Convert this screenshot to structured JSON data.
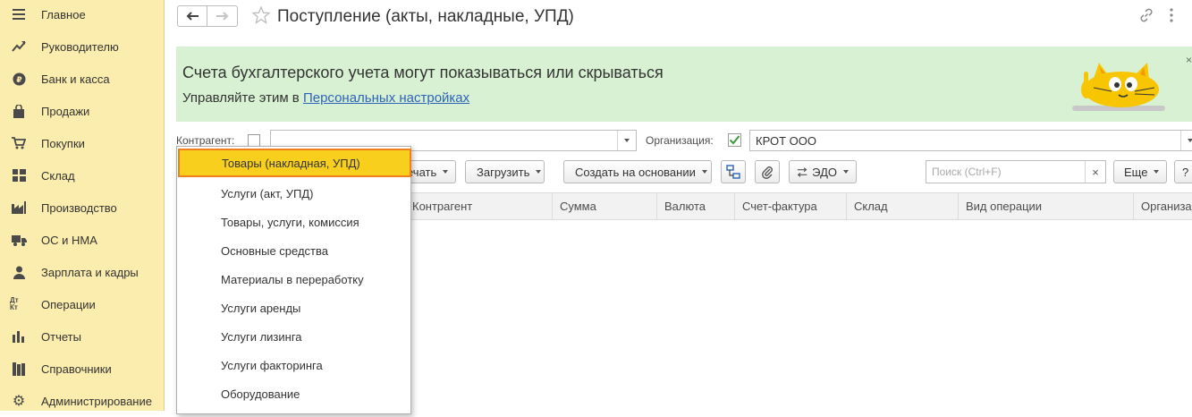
{
  "sidebar": {
    "items": [
      {
        "label": "Главное",
        "icon": "menu-icon"
      },
      {
        "label": "Руководителю",
        "icon": "chart-up-icon"
      },
      {
        "label": "Банк и касса",
        "icon": "ruble-icon"
      },
      {
        "label": "Продажи",
        "icon": "shopping-bag-icon"
      },
      {
        "label": "Покупки",
        "icon": "cart-icon"
      },
      {
        "label": "Склад",
        "icon": "warehouse-icon"
      },
      {
        "label": "Производство",
        "icon": "factory-icon"
      },
      {
        "label": "ОС и НМА",
        "icon": "truck-icon"
      },
      {
        "label": "Зарплата и кадры",
        "icon": "person-icon"
      },
      {
        "label": "Операции",
        "icon": "dt-kt-icon",
        "icon_text": "Дт Кт"
      },
      {
        "label": "Отчеты",
        "icon": "bar-chart-icon"
      },
      {
        "label": "Справочники",
        "icon": "books-icon"
      },
      {
        "label": "Администрирование",
        "icon": "gear-icon"
      }
    ]
  },
  "header": {
    "title": "Поступление (акты, накладные, УПД)"
  },
  "banner": {
    "title": "Счета бухгалтерского учета могут показываться или скрываться",
    "subtitle_prefix": "Управляйте этим в ",
    "link_text": "Персональных настройках",
    "close": "×"
  },
  "filters": {
    "counterparty_label": "Контрагент:",
    "counterparty_checked": false,
    "counterparty_value": "",
    "organization_label": "Организация:",
    "organization_checked": true,
    "organization_value": "КРОТ ООО"
  },
  "toolbar": {
    "print_label": "ечать",
    "load_label": "Загрузить",
    "create_basis_label": "Создать на основании",
    "edo_label": "ЭДО",
    "search_placeholder": "Поиск (Ctrl+F)",
    "search_clear": "×",
    "more_label": "Еще",
    "help_label": "?"
  },
  "table": {
    "columns": [
      "Контрагент",
      "Сумма",
      "Валюта",
      "Счет-фактура",
      "Склад",
      "Вид операции",
      "Организа"
    ]
  },
  "menu": {
    "selected_index": 0,
    "items": [
      "Товары (накладная, УПД)",
      "Услуги (акт, УПД)",
      "Товары, услуги, комиссия",
      "Основные средства",
      "Материалы в переработку",
      "Услуги аренды",
      "Услуги лизинга",
      "Услуги факторинга",
      "Оборудование"
    ]
  },
  "colors": {
    "sidebar_bg": "#fbedad",
    "banner_bg": "#d8f1d3",
    "link": "#2e63ba",
    "menu_selected_bg": "#f8cf1c",
    "menu_selected_border": "#f07f1e",
    "check_green": "#3c9a3c"
  }
}
